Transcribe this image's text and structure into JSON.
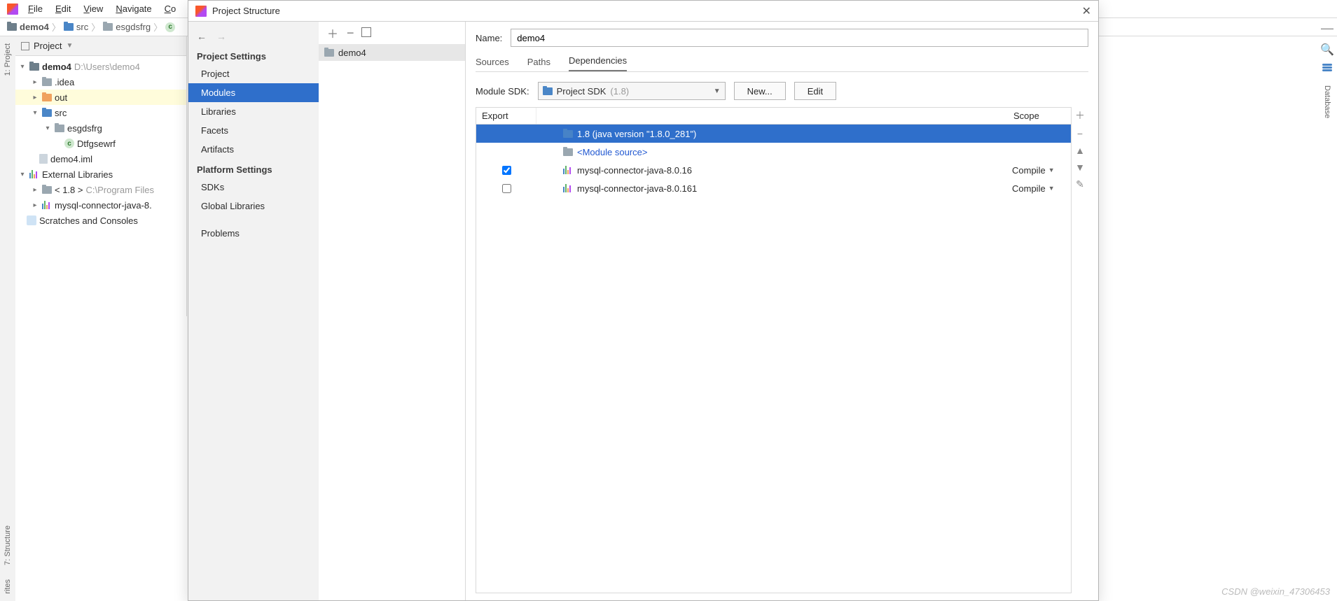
{
  "menubar": {
    "file": "File",
    "edit": "Edit",
    "view": "View",
    "navigate": "Navigate",
    "code": "Co"
  },
  "breadcrumbs": {
    "c1": "demo4",
    "c2": "src",
    "c3": "esgdsfrg"
  },
  "leftGutter": {
    "project": "1: Project",
    "structure": "7: Structure",
    "favorites": "rites"
  },
  "projectPanel": {
    "headerLabel": "Project",
    "rootName": "demo4",
    "rootPath": "D:\\Users\\demo4",
    "idea": ".idea",
    "out": "out",
    "src": "src",
    "pkg": "esgdsfrg",
    "cls": "Dtfgsewrf",
    "iml": "demo4.iml",
    "extLabel": "External Libraries",
    "jdkLabel": "< 1.8 >",
    "jdkPath": "C:\\Program Files",
    "mysqlLib": "mysql-connector-java-8.",
    "scratches": "Scratches and Consoles"
  },
  "dialog": {
    "title": "Project Structure",
    "nav": {
      "projSettings": "Project Settings",
      "project": "Project",
      "modules": "Modules",
      "libraries": "Libraries",
      "facets": "Facets",
      "artifacts": "Artifacts",
      "platSettings": "Platform Settings",
      "sdks": "SDKs",
      "globalLibs": "Global Libraries",
      "problems": "Problems"
    },
    "moduleEntry": "demo4",
    "right": {
      "nameLabel": "Name:",
      "nameValue": "demo4",
      "tabs": {
        "sources": "Sources",
        "paths": "Paths",
        "dependencies": "Dependencies"
      },
      "sdkLabel": "Module SDK:",
      "sdkValue": "Project SDK",
      "sdkVer": "(1.8)",
      "newBtn": "New...",
      "editBtn": "Edit",
      "tblExport": "Export",
      "tblScope": "Scope",
      "r0": "1.8 (java version \"1.8.0_281\")",
      "r1": "<Module source>",
      "r2": "mysql-connector-java-8.0.16",
      "r2scope": "Compile",
      "r3": "mysql-connector-java-8.0.161",
      "r3scope": "Compile"
    }
  },
  "rightStrip": {
    "database": "Database"
  },
  "watermark": "CSDN @weixin_47306453"
}
